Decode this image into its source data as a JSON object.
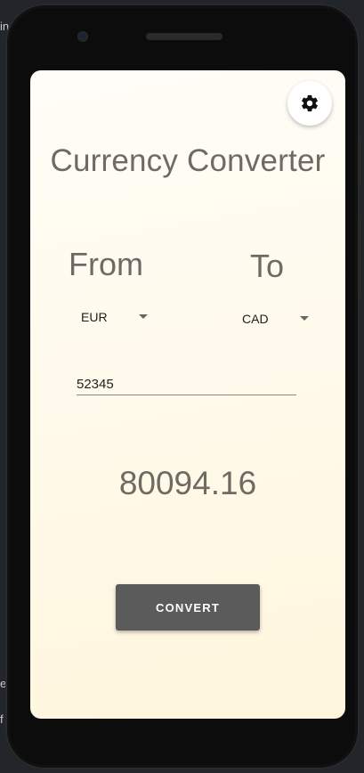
{
  "app": {
    "title": "Currency Converter"
  },
  "background": {
    "left_texts": [
      "in",
      "er",
      "f"
    ]
  },
  "settings": {
    "icon": "gear-icon"
  },
  "from": {
    "label": "From",
    "selected": "EUR"
  },
  "to": {
    "label": "To",
    "selected": "CAD"
  },
  "amount": {
    "value": "52345"
  },
  "result": {
    "value": "80094.16"
  },
  "convert": {
    "label": "CONVERT"
  },
  "colors": {
    "screen_bg": "#fffaec",
    "text_primary": "#6f6a64",
    "button_bg": "#5b5b5b",
    "button_text": "#ffffff"
  }
}
